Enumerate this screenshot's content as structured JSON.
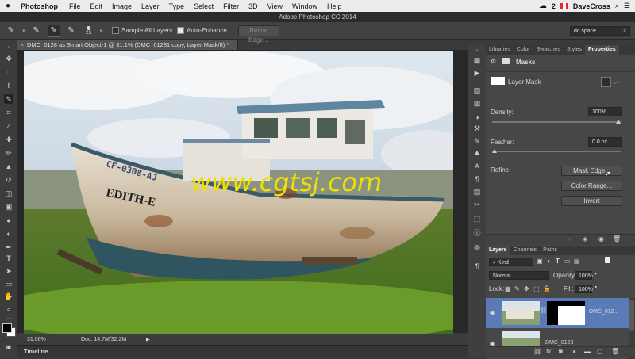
{
  "menubar": {
    "app_name": "Photoshop",
    "items": [
      "File",
      "Edit",
      "Image",
      "Layer",
      "Type",
      "Select",
      "Filter",
      "3D",
      "View",
      "Window",
      "Help"
    ],
    "notification_count": "2",
    "user_name": "DaveCross"
  },
  "window": {
    "title": "Adobe Photoshop CC 2014"
  },
  "options_bar": {
    "brush_size": "25",
    "sample_all_layers": "Sample All Layers",
    "auto_enhance": "Auto-Enhance",
    "refine_edge": "Refine Edge...",
    "workspace": "dc space"
  },
  "document": {
    "tab_title": "DMC_0128 as Smart Object-1 @ 31.1% (DMC_01281 copy, Layer Mask/8) *",
    "close_glyph": "×",
    "zoom": "31.06%",
    "doc_info": "Doc: 14.7M/32.2M",
    "watermark": "www.cgtsj.com",
    "boat_name": "EDITH-E",
    "boat_registration": "CF-0308-AJ"
  },
  "timeline_label": "Timeline",
  "properties_panel": {
    "tabs": [
      "Libraries",
      "Color",
      "Swatches",
      "Styles",
      "Properties"
    ],
    "active_tab": "Properties",
    "section_title": "Masks",
    "mask_label": "Layer Mask",
    "density_label": "Density:",
    "density_value": "100%",
    "density_fraction": 1.0,
    "feather_label": "Feather:",
    "feather_value": "0.0 px",
    "feather_fraction": 0.0,
    "refine_label": "Refine:",
    "mask_edge_button": "Mask Edge...",
    "color_range_button": "Color Range...",
    "invert_button": "Invert"
  },
  "layers_panel": {
    "tabs": [
      "Layers",
      "Channels",
      "Paths"
    ],
    "active_tab": "Layers",
    "filter_kind": "Kind",
    "blend_mode": "Normal",
    "opacity_label": "Opacity:",
    "opacity_value": "100%",
    "lock_label": "Lock:",
    "fill_label": "Fill:",
    "fill_value": "100%",
    "layers": [
      {
        "name": "DMC_012...",
        "selected": true
      },
      {
        "name": "DMC_0128",
        "selected": false
      }
    ]
  },
  "colors": {
    "accent_blue": "#5b7ab8",
    "panel_bg": "#474747",
    "watermark": "#f0e000"
  }
}
